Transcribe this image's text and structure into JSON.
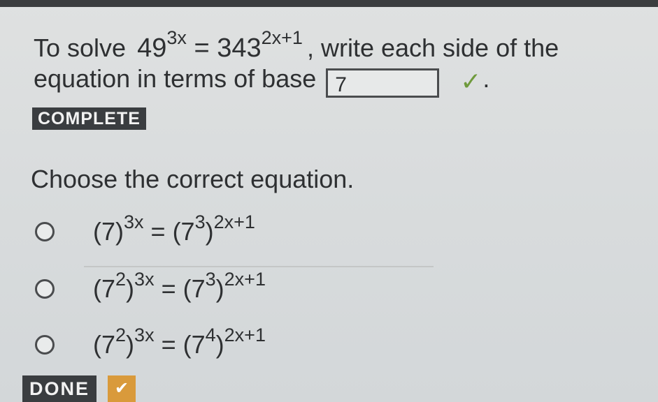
{
  "question": {
    "prefix": "To solve",
    "lhs_base": "49",
    "lhs_exp": "3x",
    "equals": "=",
    "rhs_base": "343",
    "rhs_exp": "2x+1",
    "suffix": ", write each side of the",
    "line2": "equation in terms of base",
    "answer_value": "7",
    "period": ".",
    "status_icon": "check-icon"
  },
  "status": {
    "complete_label": "COMPLETE"
  },
  "prompt": "Choose the correct equation.",
  "options": [
    {
      "lhs_open": "(7)",
      "lhs_exp": "3x",
      "eq": " = ",
      "rhs_open": "(7",
      "rhs_inner_exp": "3",
      "rhs_close": ")",
      "rhs_exp": "2x+1"
    },
    {
      "lhs_open": "(7",
      "lhs_inner_exp": "2",
      "lhs_close": ")",
      "lhs_exp": "3x",
      "eq": " = ",
      "rhs_open": "(7",
      "rhs_inner_exp": "3",
      "rhs_close": ")",
      "rhs_exp": "2x+1"
    },
    {
      "lhs_open": "(7",
      "lhs_inner_exp": "2",
      "lhs_close": ")",
      "lhs_exp": "3x",
      "eq": " = ",
      "rhs_open": "(7",
      "rhs_inner_exp": "4",
      "rhs_close": ")",
      "rhs_exp": "2x+1"
    }
  ],
  "done": {
    "label": "DONE",
    "icon": "check-icon"
  },
  "colors": {
    "badge_bg": "#3a3d40",
    "check_green": "#6f9a3c",
    "done_accent": "#d99a3b"
  }
}
